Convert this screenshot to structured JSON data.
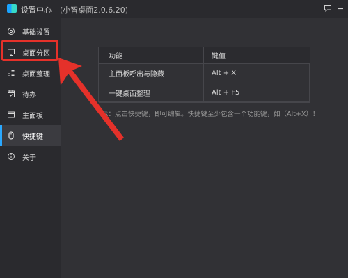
{
  "title_bar": {
    "app_title": "设置中心",
    "version": "(小智桌面2.0.6.20)",
    "icons": [
      "chat-icon",
      "minimize-icon"
    ]
  },
  "sidebar": {
    "items": [
      {
        "label": "基础设置",
        "icon": "gear-icon"
      },
      {
        "label": "桌面分区",
        "icon": "monitor-icon"
      },
      {
        "label": "桌面整理",
        "icon": "list-icon"
      },
      {
        "label": "待办",
        "icon": "calendar-check-icon"
      },
      {
        "label": "主面板",
        "icon": "window-icon"
      },
      {
        "label": "快捷键",
        "icon": "mouse-icon"
      },
      {
        "label": "关于",
        "icon": "info-icon"
      }
    ],
    "active_index": 5
  },
  "shortcuts": {
    "headers": [
      "功能",
      "键值"
    ],
    "rows": [
      {
        "function": "主面板呼出与隐藏",
        "key": "Alt + X"
      },
      {
        "function": "一键桌面整理",
        "key": "Alt + F5"
      }
    ]
  },
  "tip": "示：点击快捷键，即可编辑。快捷键至少包含一个功能键，如（Alt+X）！",
  "colors": {
    "accent": "#2aa8ff",
    "highlight": "#e5312a"
  }
}
